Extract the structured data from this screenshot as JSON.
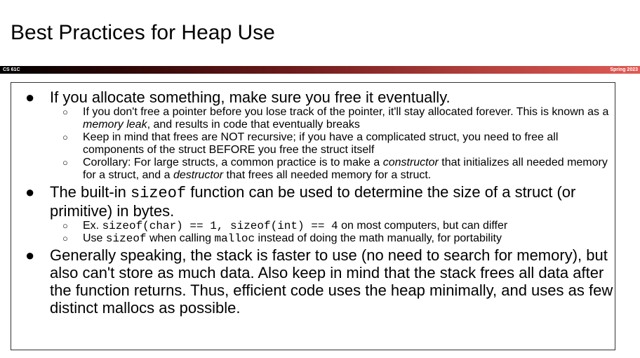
{
  "slide": {
    "title": "Best Practices for Heap Use",
    "course": "CS 61C",
    "term": "Spring 2023"
  },
  "bullets": {
    "b1": {
      "text": "If you allocate something, make sure you free it eventually.",
      "s1": {
        "a": "If you don't free a pointer before you lose track of the pointer, it'll stay allocated forever. This is known as a ",
        "em": "memory leak",
        "b": ", and results in code that eventually breaks"
      },
      "s2": "Keep in mind that frees are NOT recursive; if you have a complicated struct, you need to free all components of the struct BEFORE you free the struct itself",
      "s3": {
        "a": "Corollary: For large structs, a common practice is to make a ",
        "em1": "constructor",
        "b": " that initializes all needed memory for a struct, and a ",
        "em2": "destructor",
        "c": " that frees all needed memory for a struct."
      }
    },
    "b2": {
      "a": "The built-in ",
      "code": "sizeof",
      "b": " function can be used to determine the size of a struct (or primitive) in bytes.",
      "s1": {
        "a": "Ex. ",
        "code": "sizeof(char) == 1, sizeof(int) == 4",
        "b": " on most computers, but can differ"
      },
      "s2": {
        "a": "Use ",
        "code1": "sizeof",
        "b": " when calling ",
        "code2": "malloc",
        "c": " instead of doing the math manually, for portability"
      }
    },
    "b3": {
      "text": "Generally speaking, the stack is faster to use (no need to search for memory), but also can't store as much data. Also keep in mind that the stack frees all data after the function returns. Thus, efficient code uses the heap minimally, and uses as few distinct mallocs as possible."
    },
    "level1_marker": "●",
    "level2_marker": "○"
  }
}
